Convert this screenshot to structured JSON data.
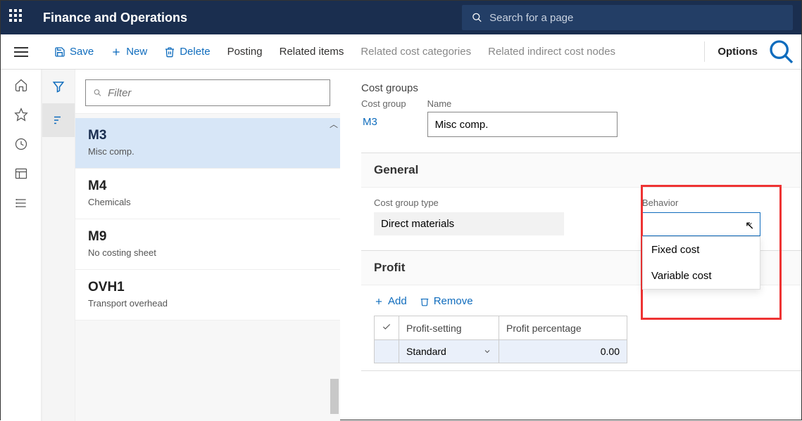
{
  "app_title": "Finance and Operations",
  "search_placeholder": "Search for a page",
  "commands": {
    "save": "Save",
    "new": "New",
    "delete": "Delete",
    "posting": "Posting",
    "related_items": "Related items",
    "related_cost_categories": "Related cost categories",
    "related_indirect_cost_nodes": "Related indirect cost nodes",
    "options": "Options"
  },
  "filter_placeholder": "Filter",
  "list": [
    {
      "code": "M3",
      "desc": "Misc comp.",
      "selected": true
    },
    {
      "code": "M4",
      "desc": "Chemicals",
      "selected": false
    },
    {
      "code": "M9",
      "desc": "No costing sheet",
      "selected": false
    },
    {
      "code": "OVH1",
      "desc": "Transport overhead",
      "selected": false
    }
  ],
  "page_title": "Cost groups",
  "header_fields": {
    "cost_group_label": "Cost group",
    "cost_group_value": "M3",
    "name_label": "Name",
    "name_value": "Misc comp."
  },
  "general": {
    "section": "General",
    "cgt_label": "Cost group type",
    "cgt_value": "Direct materials",
    "behavior_label": "Behavior",
    "behavior_value": "",
    "behavior_options": [
      "Fixed cost",
      "Variable cost"
    ]
  },
  "profit": {
    "section": "Profit",
    "add": "Add",
    "remove": "Remove",
    "col_setting": "Profit-setting",
    "col_pct": "Profit percentage",
    "row_setting": "Standard",
    "row_pct": "0.00"
  }
}
